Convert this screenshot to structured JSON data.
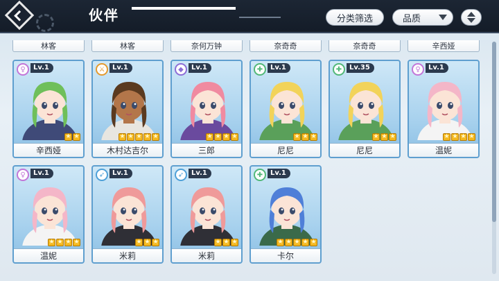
{
  "header": {
    "title": "伙伴",
    "filter_label": "分类筛选",
    "quality_label": "品质"
  },
  "previous_row_labels": [
    "林客",
    "林客",
    "奈何万钟",
    "奈奇奇",
    "奈奇奇",
    "辛西娅"
  ],
  "partners": [
    {
      "name": "辛西娅",
      "level": "Lv.1",
      "stars": 2,
      "class_icon": "venus-icon",
      "class_color": "#c276d8",
      "hair": "#6fbf5a",
      "skin": "#fbe4d6",
      "outfit": "#3f4a78"
    },
    {
      "name": "木村达吉尔",
      "level": "Lv.1",
      "stars": 5,
      "class_icon": "sword-icon",
      "class_color": "#e49a2e",
      "hair": "#5a3a20",
      "skin": "#b3764a",
      "outfit": "#e8e6e0"
    },
    {
      "name": "三郎",
      "level": "Lv.1",
      "stars": 4,
      "class_icon": "shield-icon",
      "class_color": "#8c6ed6",
      "hair": "#f08aa0",
      "skin": "#fbe4d6",
      "outfit": "#6a4a9e"
    },
    {
      "name": "尼尼",
      "level": "Lv.1",
      "stars": 3,
      "class_icon": "cross-icon",
      "class_color": "#52b878",
      "hair": "#f2d35a",
      "skin": "#fbe4d6",
      "outfit": "#5aa05a"
    },
    {
      "name": "尼尼",
      "level": "Lv.35",
      "stars": 3,
      "class_icon": "cross-icon",
      "class_color": "#52b878",
      "hair": "#f2d35a",
      "skin": "#fbe4d6",
      "outfit": "#5aa05a"
    },
    {
      "name": "温妮",
      "level": "Lv.1",
      "stars": 4,
      "class_icon": "venus-icon",
      "class_color": "#c276d8",
      "hair": "#f4b6c8",
      "skin": "#fbe4d6",
      "outfit": "#f4f4f4"
    },
    {
      "name": "温妮",
      "level": "Lv.1",
      "stars": 4,
      "class_icon": "venus-icon",
      "class_color": "#c276d8",
      "hair": "#f4b6c8",
      "skin": "#fbe4d6",
      "outfit": "#f4f4f4"
    },
    {
      "name": "米莉",
      "level": "Lv.1",
      "stars": 3,
      "class_icon": "bow-icon",
      "class_color": "#4ea0d8",
      "hair": "#ef9a9a",
      "skin": "#fbe4d6",
      "outfit": "#2f2f36"
    },
    {
      "name": "米莉",
      "level": "Lv.1",
      "stars": 3,
      "class_icon": "bow-icon",
      "class_color": "#4ea0d8",
      "hair": "#ef9a9a",
      "skin": "#fbe4d6",
      "outfit": "#2f2f36"
    },
    {
      "name": "卡尔",
      "level": "Lv.1",
      "stars": 5,
      "class_icon": "cross-icon",
      "class_color": "#52b878",
      "hair": "#4f7fd8",
      "skin": "#fbe4d6",
      "outfit": "#3a6a4a"
    }
  ]
}
